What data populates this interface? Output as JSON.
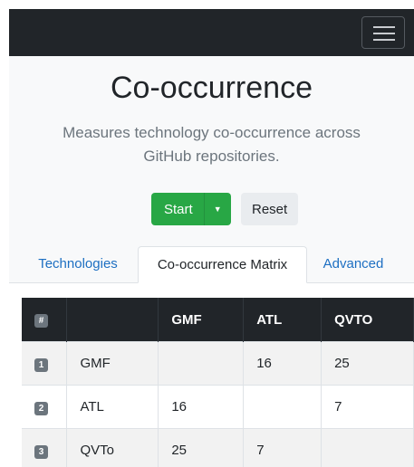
{
  "navbar": {
    "menu_icon": "hamburger-menu-icon"
  },
  "header": {
    "title": "Co-occurrence",
    "lead_line1": "Measures technology co-occurrence across",
    "lead_line2": "GitHub repositories."
  },
  "actions": {
    "start_label": "Start",
    "dropdown_icon": "caret-down-icon",
    "reset_label": "Reset",
    "start_color": "#28a745"
  },
  "tabs": [
    {
      "label": "Technologies",
      "active": false
    },
    {
      "label": "Co-occurrence Matrix",
      "active": true
    },
    {
      "label": "Advanced",
      "active": false
    }
  ],
  "matrix": {
    "headers": [
      "#",
      "",
      "GMF",
      "ATL",
      "QVTO"
    ],
    "rows": [
      {
        "index": "1",
        "name": "GMF",
        "cells": [
          "",
          "16",
          "25"
        ]
      },
      {
        "index": "2",
        "name": "ATL",
        "cells": [
          "16",
          "",
          "7"
        ]
      },
      {
        "index": "3",
        "name": "QVTo",
        "cells": [
          "25",
          "7",
          ""
        ]
      }
    ]
  }
}
